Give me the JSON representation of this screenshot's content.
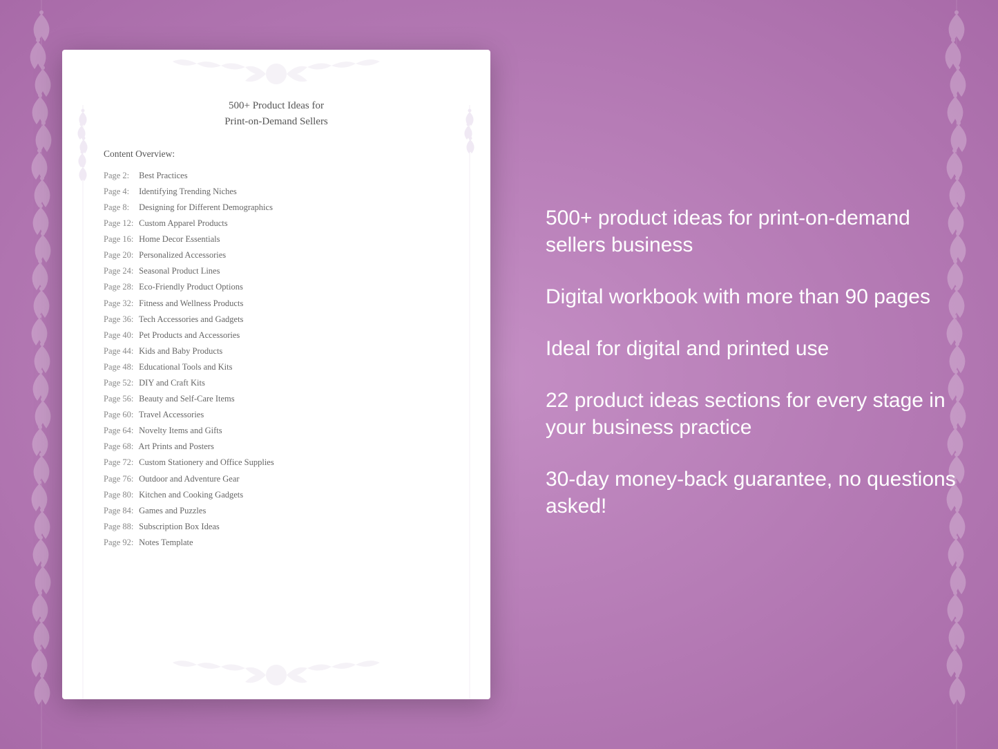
{
  "page": {
    "title_line1": "500+ Product Ideas for",
    "title_line2": "Print-on-Demand Sellers",
    "overview_label": "Content Overview:",
    "toc_items": [
      {
        "page": "Page  2:",
        "title": "Best Practices"
      },
      {
        "page": "Page  4:",
        "title": "Identifying Trending Niches"
      },
      {
        "page": "Page  8:",
        "title": "Designing for Different Demographics"
      },
      {
        "page": "Page 12:",
        "title": "Custom Apparel Products"
      },
      {
        "page": "Page 16:",
        "title": "Home Decor Essentials"
      },
      {
        "page": "Page 20:",
        "title": "Personalized Accessories"
      },
      {
        "page": "Page 24:",
        "title": "Seasonal Product Lines"
      },
      {
        "page": "Page 28:",
        "title": "Eco-Friendly Product Options"
      },
      {
        "page": "Page 32:",
        "title": "Fitness and Wellness Products"
      },
      {
        "page": "Page 36:",
        "title": "Tech Accessories and Gadgets"
      },
      {
        "page": "Page 40:",
        "title": "Pet Products and Accessories"
      },
      {
        "page": "Page 44:",
        "title": "Kids and Baby Products"
      },
      {
        "page": "Page 48:",
        "title": "Educational Tools and Kits"
      },
      {
        "page": "Page 52:",
        "title": "DIY and Craft Kits"
      },
      {
        "page": "Page 56:",
        "title": "Beauty and Self-Care Items"
      },
      {
        "page": "Page 60:",
        "title": "Travel Accessories"
      },
      {
        "page": "Page 64:",
        "title": "Novelty Items and Gifts"
      },
      {
        "page": "Page 68:",
        "title": "Art Prints and Posters"
      },
      {
        "page": "Page 72:",
        "title": "Custom Stationery and Office Supplies"
      },
      {
        "page": "Page 76:",
        "title": "Outdoor and Adventure Gear"
      },
      {
        "page": "Page 80:",
        "title": "Kitchen and Cooking Gadgets"
      },
      {
        "page": "Page 84:",
        "title": "Games and Puzzles"
      },
      {
        "page": "Page 88:",
        "title": "Subscription Box Ideas"
      },
      {
        "page": "Page 92:",
        "title": "Notes Template"
      }
    ]
  },
  "features": [
    "500+ product ideas for print-on-demand sellers business",
    "Digital workbook with more than 90 pages",
    "Ideal for digital and printed use",
    "22 product ideas sections for every stage in your business practice",
    "30-day money-back guarantee, no questions asked!"
  ]
}
